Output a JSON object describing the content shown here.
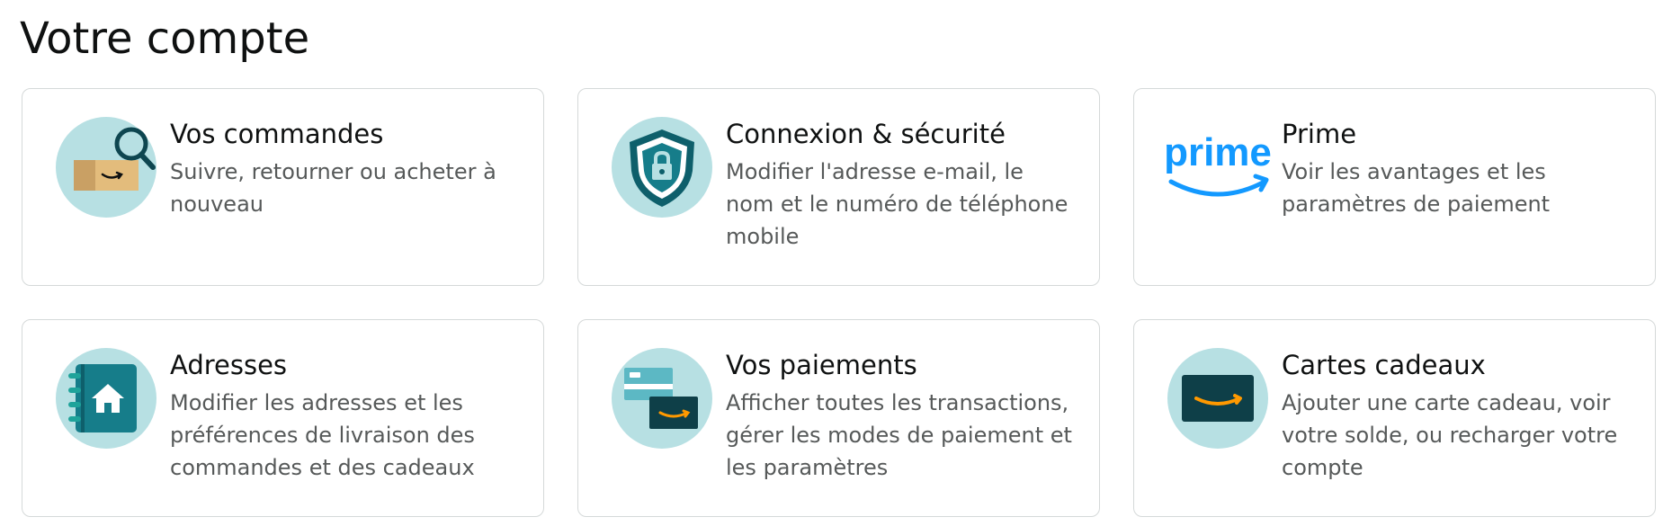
{
  "page": {
    "title": "Votre compte"
  },
  "colors": {
    "icon_circle": "#b7e0e3",
    "teal_dark": "#0e5f6b",
    "teal": "#167d8a",
    "amazon_orange": "#ff9900",
    "prime_blue": "#1399ff",
    "box_tan": "#e3bc7c",
    "card_border": "#d5d9d9",
    "desc_text": "#565959"
  },
  "cards": [
    {
      "icon": "package-search-icon",
      "title": "Vos commandes",
      "description": "Suivre, retourner ou acheter à nouveau"
    },
    {
      "icon": "shield-lock-icon",
      "title": "Connexion & sécurité",
      "description": "Modifier l'adresse e-mail, le nom et le numéro de téléphone mobile"
    },
    {
      "icon": "prime-logo-icon",
      "title": "Prime",
      "description": "Voir les avantages et les paramètres de paiement",
      "logo_text": "prime"
    },
    {
      "icon": "address-book-icon",
      "title": "Adresses",
      "description": "Modifier les adresses et les préférences de livraison des commandes et des cadeaux"
    },
    {
      "icon": "payment-cards-icon",
      "title": "Vos paiements",
      "description": "Afficher toutes les transactions, gérer les modes de paiement et les paramètres"
    },
    {
      "icon": "gift-card-icon",
      "title": "Cartes cadeaux",
      "description": "Ajouter une carte cadeau, voir votre solde, ou recharger votre compte"
    }
  ]
}
